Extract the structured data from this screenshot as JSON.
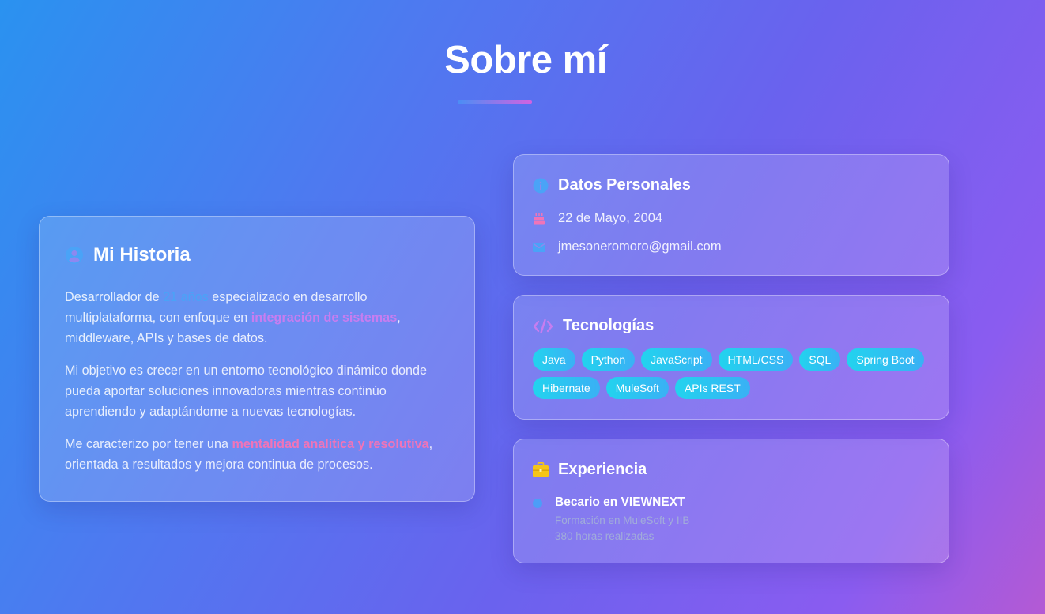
{
  "page": {
    "title": "Sobre mí"
  },
  "historia": {
    "heading": "Mi Historia",
    "icon": "user-circle-icon",
    "p1": {
      "pre": "Desarrollador de ",
      "hl1": "21 años",
      "mid": " especializado en desarrollo multiplataforma, con enfoque en ",
      "hl2": "integración de sistemas",
      "post": ", middleware, APIs y bases de datos."
    },
    "p2": "Mi objetivo es crecer en un entorno tecnológico dinámico donde pueda aportar soluciones innovadoras mientras continúo aprendiendo y adaptándome a nuevas tecnologías.",
    "p3": {
      "pre": "Me caracterizo por tener una ",
      "hl": "mentalidad analítica y resolutiva",
      "post": ", orientada a resultados y mejora continua de procesos."
    }
  },
  "datos": {
    "heading": "Datos Personales",
    "icon": "info-circle-icon",
    "birthday": "22 de Mayo, 2004",
    "email": "jmesoneromoro@gmail.com"
  },
  "tecnologias": {
    "heading": "Tecnologías",
    "icon": "code-icon",
    "items": [
      "Java",
      "Python",
      "JavaScript",
      "HTML/CSS",
      "SQL",
      "Spring Boot",
      "Hibernate",
      "MuleSoft",
      "APIs REST"
    ]
  },
  "experiencia": {
    "heading": "Experiencia",
    "icon": "briefcase-icon",
    "job_title": "Becario en VIEWNEXT",
    "line1": "Formación en MuleSoft y IIB",
    "line2": "380 horas realizadas"
  },
  "colors": {
    "accent_blue": "#4aa3f7",
    "accent_purple": "#c77df0",
    "accent_pink": "#f074b8",
    "pill": "#22d3ee"
  }
}
